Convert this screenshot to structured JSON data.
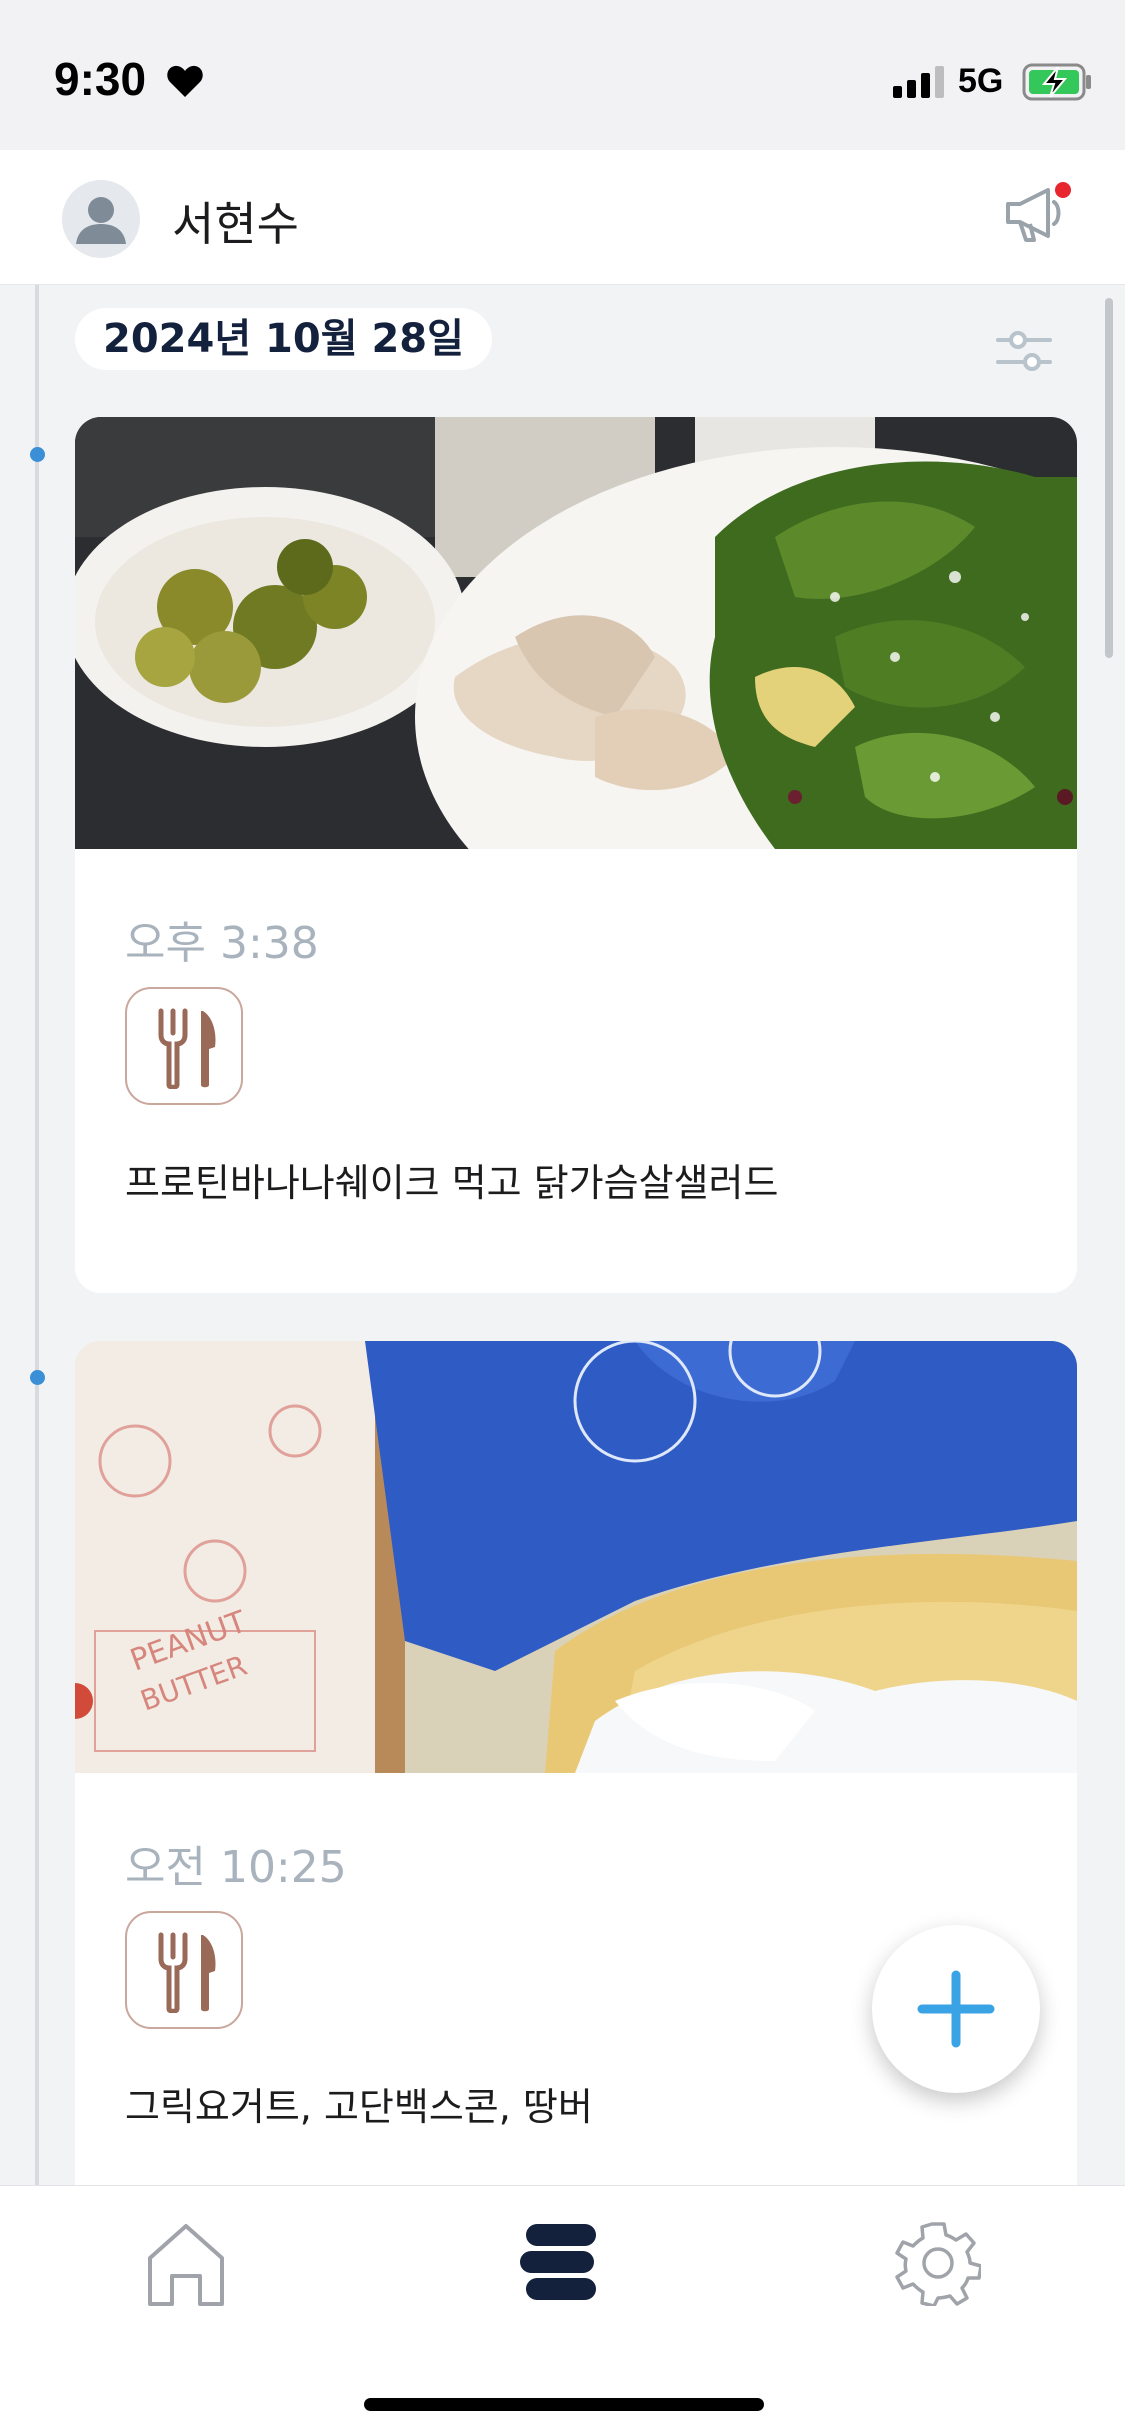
{
  "status_bar": {
    "time": "9:30",
    "network": "5G",
    "icons": [
      "heart-icon",
      "signal-icon",
      "battery-charging-icon"
    ]
  },
  "header": {
    "user_name": "서현수",
    "icons": [
      "avatar-icon",
      "megaphone-icon"
    ],
    "notification_dot_color": "#e8262d"
  },
  "feed": {
    "date_label": "2024년 10월 28일",
    "filter_icon": "sliders-icon",
    "entries": [
      {
        "time": "오후 3:38",
        "category_icon": "fork-knife-icon",
        "note": "프로틴바나나쉐이크 먹고 닭가슴살샐러드"
      },
      {
        "time": "오전 10:25",
        "category_icon": "fork-knife-icon",
        "note": "그릭요거트, 고단백스콘, 땅버"
      }
    ]
  },
  "fab": {
    "icon": "plus-icon",
    "color": "#3aa3e6"
  },
  "tab_bar": {
    "tabs": [
      {
        "icon": "home-icon",
        "active": false
      },
      {
        "icon": "timeline-stack-icon",
        "active": true
      },
      {
        "icon": "gear-icon",
        "active": false
      }
    ],
    "active_color": "#14213d",
    "inactive_color": "#a0a4aa"
  },
  "colors": {
    "accent_blue": "#3a8fd6",
    "date_text": "#14213d",
    "muted_time": "#a9b3bd",
    "badge_border": "#c9a79c"
  }
}
